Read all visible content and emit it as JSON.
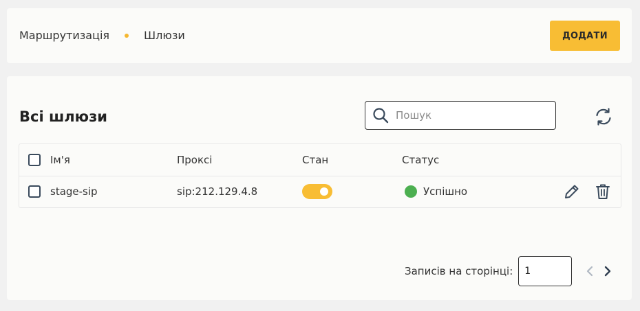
{
  "breadcrumb": {
    "parent": "Маршрутизація",
    "current": "Шлюзи"
  },
  "toolbar": {
    "add_label": "ДОДАТИ"
  },
  "page": {
    "title": "Всі шлюзи"
  },
  "search": {
    "placeholder": "Пошук",
    "value": ""
  },
  "table": {
    "columns": {
      "name": "Ім'я",
      "proxy": "Проксі",
      "state": "Стан",
      "status": "Статус"
    },
    "rows": [
      {
        "name": "stage-sip",
        "proxy": "sip:212.129.4.8",
        "state_on": true,
        "status": "Успішно"
      }
    ]
  },
  "pagination": {
    "label": "Записів на сторінці:",
    "per_page": "1"
  },
  "colors": {
    "accent": "#f8bd34",
    "success": "#4caf50"
  },
  "icons": {
    "search": "search-icon",
    "refresh": "refresh-icon",
    "edit": "pencil-icon",
    "delete": "trash-icon",
    "prev": "chevron-left-icon",
    "next": "chevron-right-icon"
  }
}
